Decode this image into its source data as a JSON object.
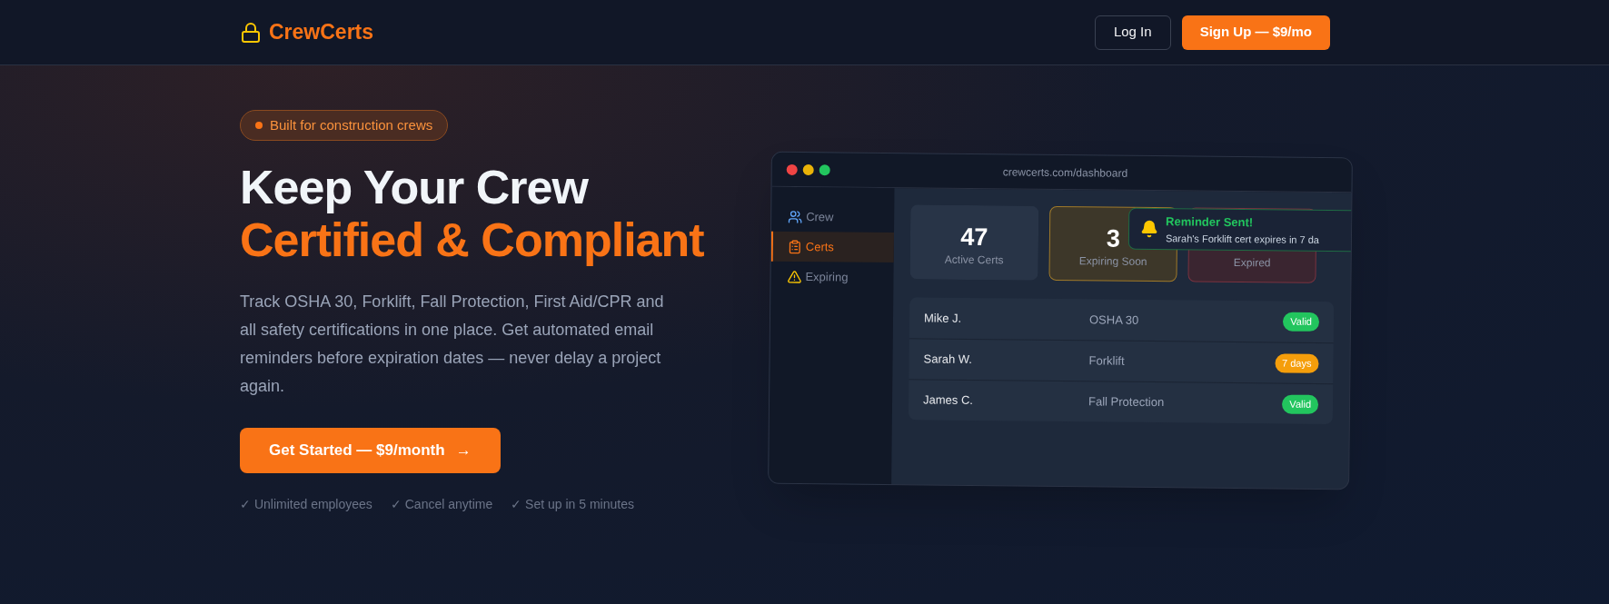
{
  "header": {
    "logo": "CrewCerts",
    "login": "Log In",
    "signup": "Sign Up — $9/mo"
  },
  "hero": {
    "badge": "Built for construction crews",
    "title_line1": "Keep Your Crew",
    "title_line2": "Certified & Compliant",
    "description": "Track OSHA 30, Forklift, Fall Protection, First Aid/CPR and all safety certifications in one place. Get automated email reminders before expiration dates — never delay a project again.",
    "cta": "Get Started — $9/month",
    "cta_arrow": "→",
    "perks": [
      "✓ Unlimited employees",
      "✓ Cancel anytime",
      "✓ Set up in 5 minutes"
    ]
  },
  "dashboard": {
    "url": "crewcerts.com/dashboard",
    "sidebar": [
      {
        "label": "Crew",
        "selected": false
      },
      {
        "label": "Certs",
        "selected": true
      },
      {
        "label": "Expiring",
        "selected": false
      }
    ],
    "stats": [
      {
        "value": "47",
        "label": "Active Certs",
        "kind": "neutral"
      },
      {
        "value": "3",
        "label": "Expiring Soon",
        "kind": "warning"
      },
      {
        "label": "Expired",
        "kind": "danger"
      }
    ],
    "rows": [
      {
        "name": "Mike J.",
        "cert": "OSHA 30",
        "status": "Valid",
        "kind": "valid"
      },
      {
        "name": "Sarah W.",
        "cert": "Forklift",
        "status": "7 days",
        "kind": "expiring"
      },
      {
        "name": "James C.",
        "cert": "Fall Protection",
        "status": "Valid",
        "kind": "valid"
      }
    ],
    "toast": {
      "title": "Reminder Sent!",
      "message": "Sarah's Forklift cert expires in 7 da"
    }
  }
}
